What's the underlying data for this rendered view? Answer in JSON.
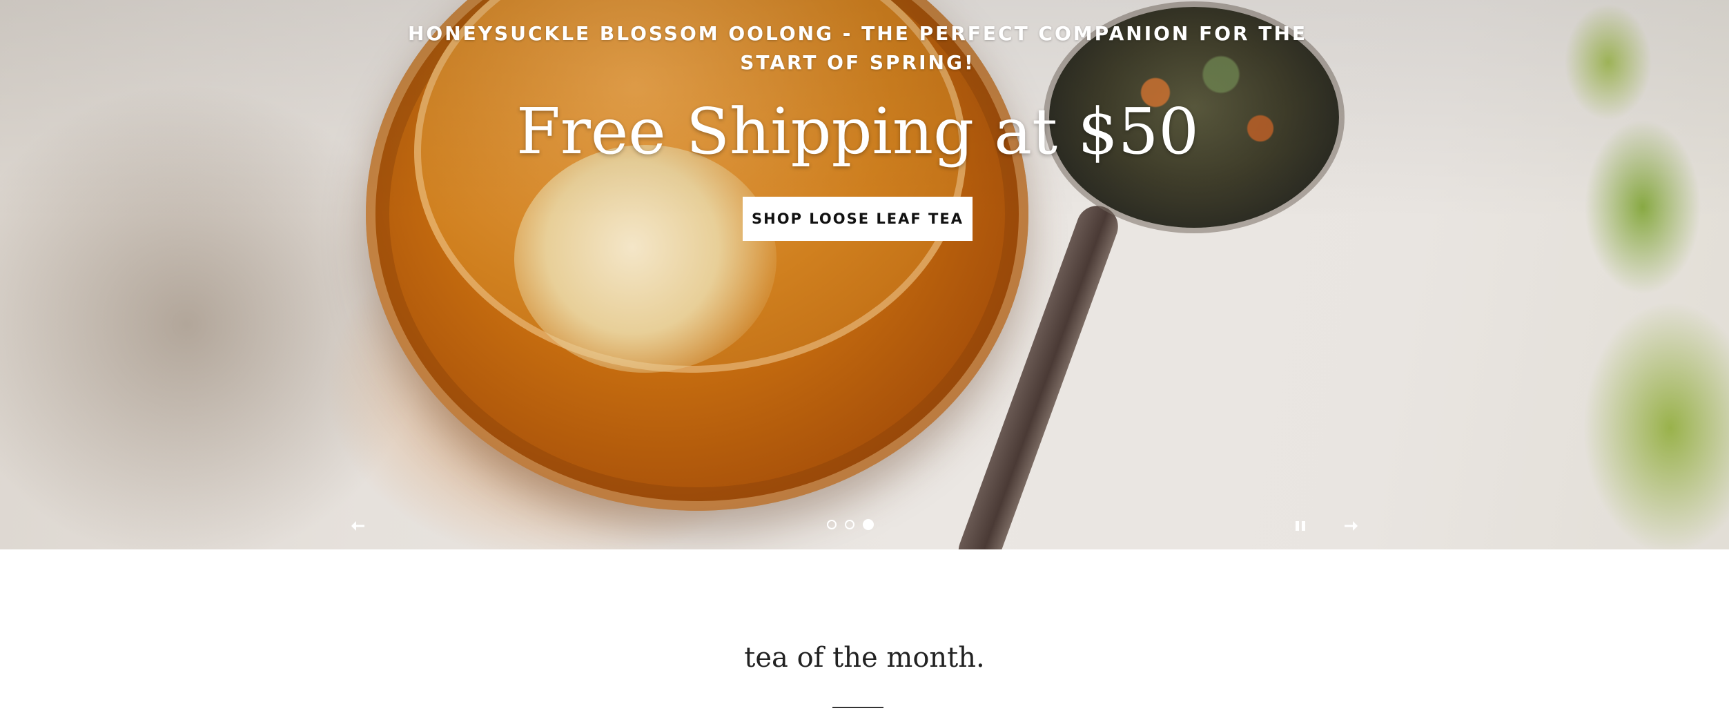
{
  "hero": {
    "subheading": "HONEYSUCKLE BLOSSOM OOLONG - THE PERFECT COMPANION FOR THE START OF SPRING!",
    "headline": "Free Shipping at $50",
    "cta_label": "SHOP LOOSE LEAF TEA",
    "slides_total": 3,
    "active_slide": 3
  },
  "icons": {
    "prev": "arrow-left-icon",
    "next": "arrow-right-icon",
    "pause": "pause-icon"
  },
  "section": {
    "title": "tea of the month."
  }
}
